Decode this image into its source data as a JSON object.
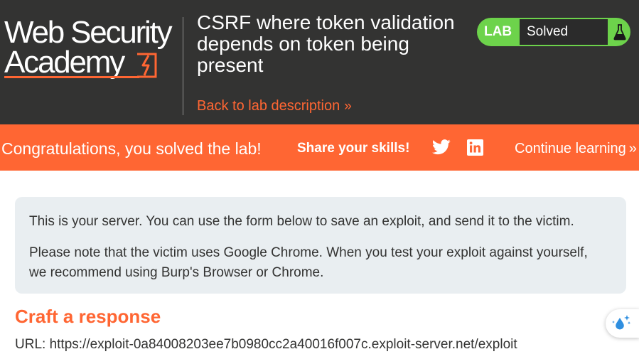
{
  "header": {
    "logo": {
      "line1": "Web Security",
      "line2": "Academy",
      "icon": "academy-lightning-logo-icon"
    },
    "lab_title": "CSRF where token validation depends on token being present",
    "back_link": {
      "label": "Back to lab description",
      "chevron": "»"
    },
    "status": {
      "tag": "LAB",
      "value": "Solved",
      "icon": "flask-icon"
    }
  },
  "banner": {
    "message": "Congratulations, you solved the lab!",
    "share_label": "Share your skills!",
    "social": [
      {
        "name": "twitter",
        "icon": "twitter-icon"
      },
      {
        "name": "linkedin",
        "icon": "linkedin-icon"
      }
    ],
    "continue_label": "Continue learning",
    "continue_chevron": "»"
  },
  "main": {
    "info_paragraph_1": "This is your server. You can use the form below to save an exploit, and send it to the victim.",
    "info_paragraph_2": "Please note that the victim uses Google Chrome. When you test your exploit against yourself, we recommend using Burp's Browser or Chrome.",
    "craft_heading": "Craft a response",
    "url_line": "URL: https://exploit-0a84008203ee7b0980cc2a40016f007c.exploit-server.net/exploit"
  },
  "floating_helper": {
    "icon": "sparkle-droplet-icon"
  },
  "colors": {
    "header_bg": "#333332",
    "accent_orange": "#ff6633",
    "solved_green": "#6dd34b",
    "info_box_bg": "#e9eef1",
    "text_dark": "#333332"
  }
}
